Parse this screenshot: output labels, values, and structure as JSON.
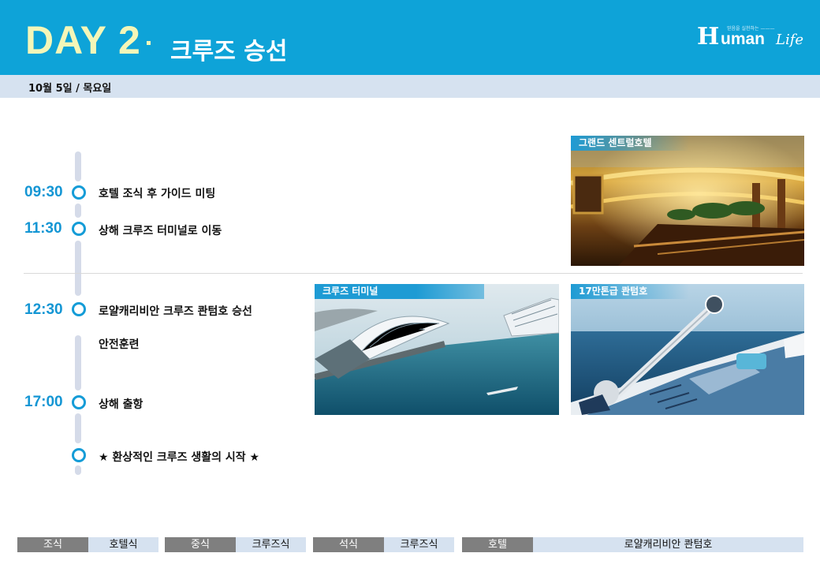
{
  "header": {
    "day": "DAY 2",
    "title": "크루즈 승선",
    "logo": {
      "tagline": "믿음을 실천하는 ———",
      "brand_h": "H",
      "brand_rest": "uman",
      "brand_life": "Life"
    }
  },
  "date": "10월 5일 / 목요일",
  "timeline": [
    {
      "time": "09:30",
      "event": "호텔 조식 후 가이드 미팅"
    },
    {
      "time": "11:30",
      "event": "상해 크루즈 터미널로 이동"
    },
    {
      "time": "12:30",
      "event": "로얄캐리비안 크루즈 콴텀호 승선"
    },
    {
      "time": "",
      "event": "안전훈련"
    },
    {
      "time": "17:00",
      "event": "상해 출항"
    },
    {
      "time": "",
      "event": "★ 환상적인 크루즈 생활의 시작 ★"
    }
  ],
  "photos": [
    {
      "caption": "그랜드 센트럴호텔"
    },
    {
      "caption": "크루즈 터미널"
    },
    {
      "caption": "17만톤급 콴텀호"
    }
  ],
  "meals": {
    "breakfast_label": "조식",
    "breakfast_value": "호텔식",
    "lunch_label": "중식",
    "lunch_value": "크루즈식",
    "dinner_label": "석식",
    "dinner_value": "크루즈식",
    "hotel_label": "호텔",
    "hotel_value": "로얄캐리비안 콴텀호"
  },
  "colors": {
    "header": "#0ea3d8",
    "accent": "#149cd7",
    "band": "#d6e2f0",
    "day_text": "#f4f6b8"
  }
}
